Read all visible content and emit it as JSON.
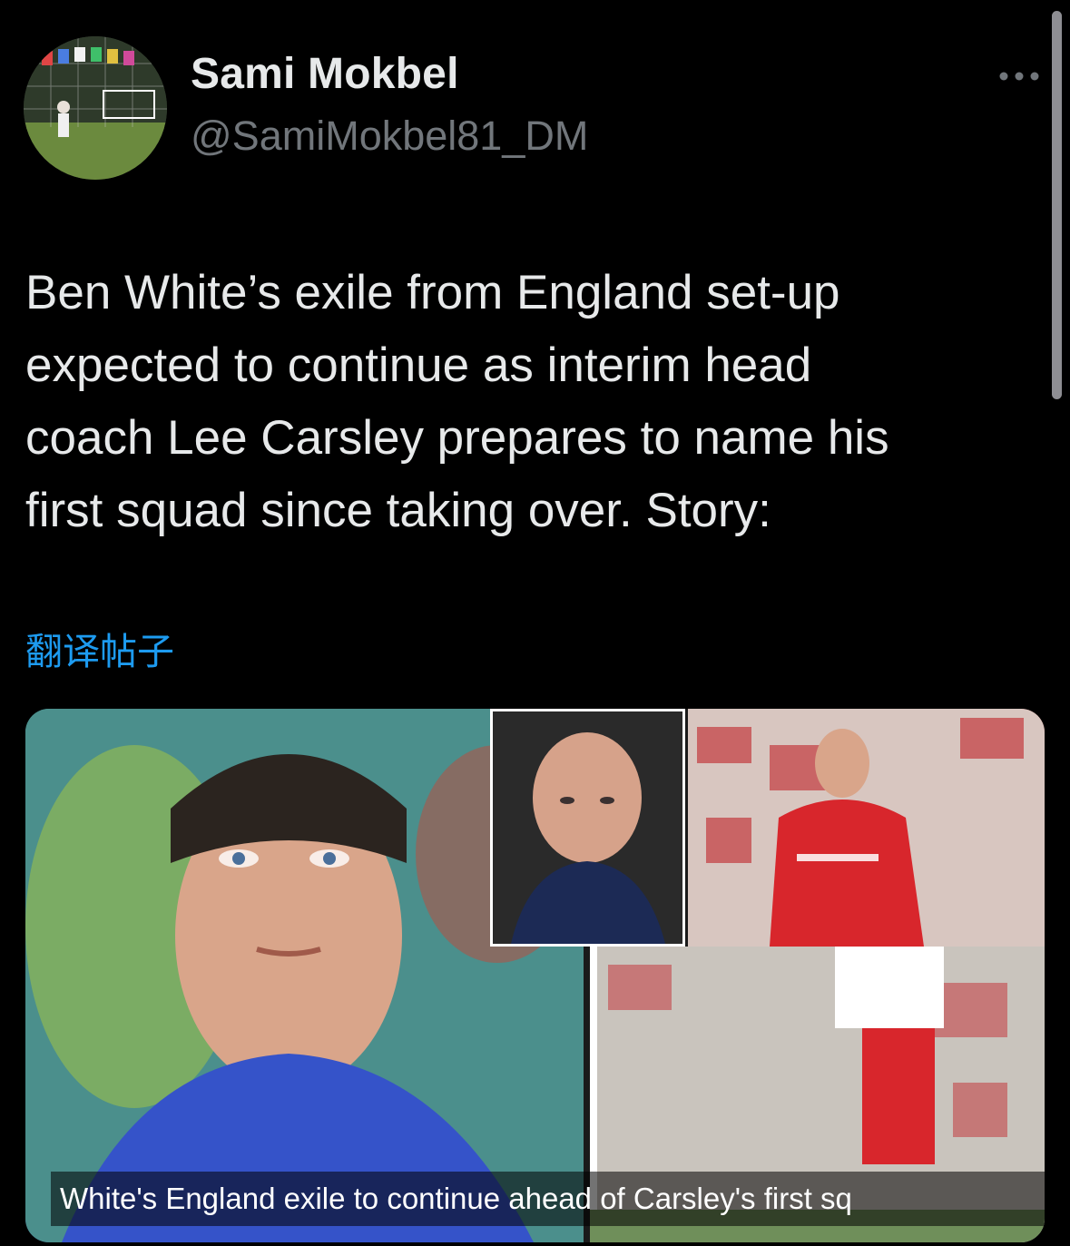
{
  "author": {
    "display_name": "Sami Mokbel",
    "handle": "@SamiMokbel81_DM"
  },
  "more_icon": "more-horizontal-icon",
  "tweet": {
    "text": "Ben White’s exile from England set-up\nexpected to continue as interim head\ncoach Lee Carsley prepares to name his\nfirst squad since taking over. Story:",
    "translate_label": "翻译帖子"
  },
  "media": {
    "caption": "White's England exile to continue ahead of Carsley's first sq"
  },
  "colors": {
    "background": "#000000",
    "link": "#1d9bf0",
    "secondary_text": "#71767b"
  }
}
